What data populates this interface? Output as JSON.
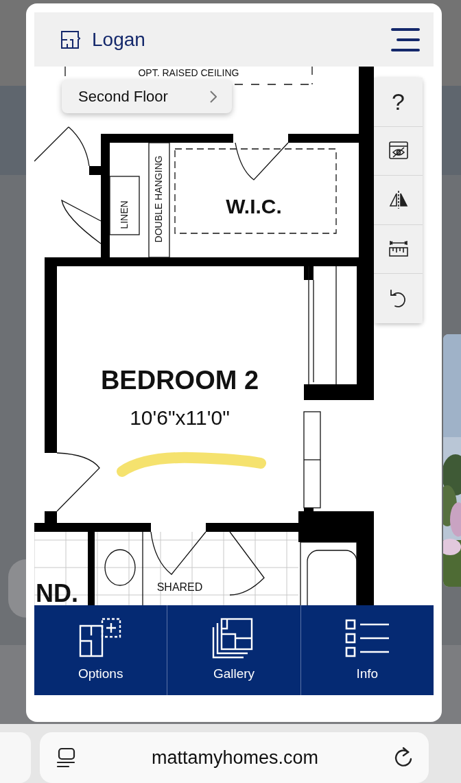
{
  "header": {
    "title": "Logan"
  },
  "floor_selector": {
    "label": "Second Floor"
  },
  "toolbar": [
    {
      "kind": "help",
      "label": "?"
    },
    {
      "kind": "hide"
    },
    {
      "kind": "mirror"
    },
    {
      "kind": "measure"
    },
    {
      "kind": "reset"
    }
  ],
  "plan": {
    "labels": [
      {
        "kind": "note",
        "text": "OPT. RAISED CEILING"
      },
      {
        "kind": "closet",
        "text": "LINEN"
      },
      {
        "kind": "closet",
        "text": "DOUBLE HANGING"
      },
      {
        "kind": "room",
        "text": "W.I.C."
      },
      {
        "kind": "room",
        "text": "BEDROOM 2"
      },
      {
        "kind": "size",
        "text": "10'6\"x11'0\""
      },
      {
        "kind": "note",
        "text": "SHARED"
      },
      {
        "kind": "room",
        "text": "ND."
      }
    ]
  },
  "bottom_nav": [
    {
      "kind": "options",
      "label": "Options"
    },
    {
      "kind": "gallery",
      "label": "Gallery"
    },
    {
      "kind": "info",
      "label": "Info"
    }
  ],
  "browser": {
    "url": "mattamyhomes.com"
  }
}
